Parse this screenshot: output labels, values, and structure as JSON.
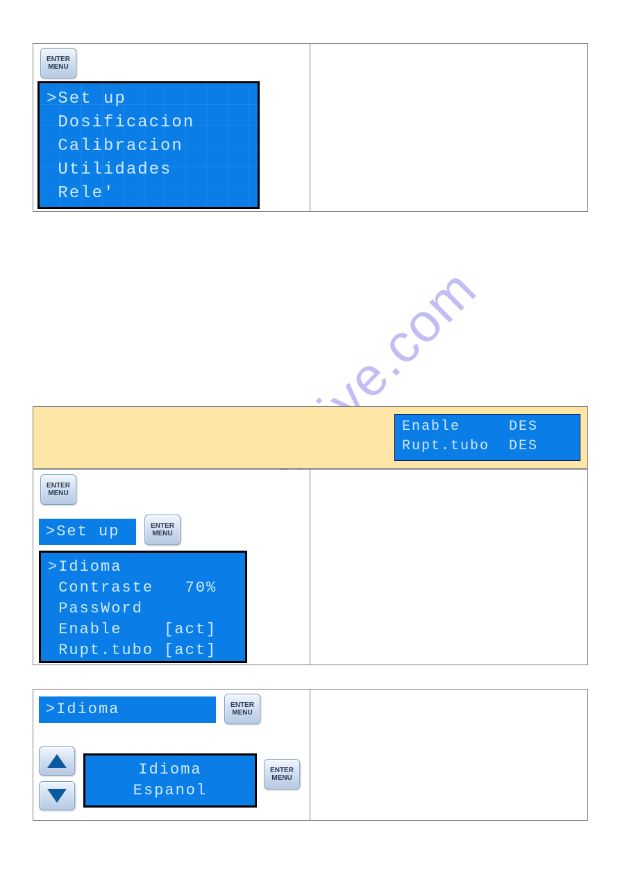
{
  "buttons": {
    "enter_line1": "ENTER",
    "enter_line2": "MENU"
  },
  "watermark": "manualshive.com",
  "panel1": {
    "lcd_main": {
      "line1": ">Set up",
      "line2": " Dosificacion",
      "line3": " Calibracion",
      "line4": " Utilidades",
      "line5": " Rele'"
    }
  },
  "yellow_band_lcd": {
    "line1": "Enable     DES",
    "line2": "Rupt.tubo  DES"
  },
  "panel2": {
    "setup_strip": ">Set up",
    "lcd_main": {
      "line1": ">Idioma",
      "line2": " Contraste   70%",
      "line3": " PassWord",
      "line4": " Enable    [act]",
      "line5": " Rupt.tubo [act]"
    }
  },
  "panel3": {
    "idioma_strip": ">Idioma",
    "lang_lcd": {
      "line1": "Idioma",
      "line2": "Espanol"
    }
  }
}
